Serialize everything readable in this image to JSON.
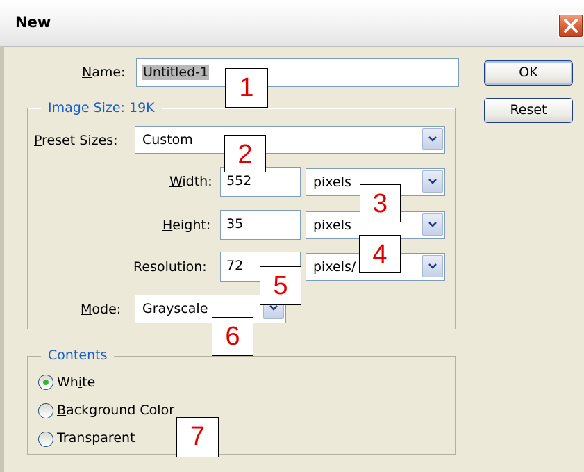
{
  "window": {
    "title": "New"
  },
  "name_field": {
    "label_prefix": "",
    "label_key": "N",
    "label_rest": "ame:",
    "value": "Untitled-1"
  },
  "buttons": {
    "ok": "OK",
    "reset": "Reset"
  },
  "image_size": {
    "group_title": "Image Size: 19K",
    "preset": {
      "label_key": "P",
      "label_rest": "reset Sizes:",
      "value": "Custom"
    },
    "width": {
      "label_key": "W",
      "label_rest": "idth:",
      "value": "552",
      "unit": "pixels"
    },
    "height": {
      "label_key": "H",
      "label_rest": "eight:",
      "value": "35",
      "unit": "pixels"
    },
    "resolution": {
      "label_key": "R",
      "label_rest": "esolution:",
      "value": "72",
      "unit": "pixels/"
    },
    "mode": {
      "label_key": "M",
      "label_rest": "ode:",
      "value": "Grayscale"
    }
  },
  "contents": {
    "group_title": "Contents",
    "options": [
      {
        "pre": "Wh",
        "key": "i",
        "post": "te",
        "checked": true
      },
      {
        "pre": "",
        "key": "B",
        "post": "ackground Color",
        "checked": false
      },
      {
        "pre": "",
        "key": "T",
        "post": "ransparent",
        "checked": false
      }
    ]
  },
  "callouts": [
    "1",
    "2",
    "3",
    "4",
    "5",
    "6",
    "7"
  ],
  "colors": {
    "dialog_bg": "#ece9d8",
    "group_title": "#1a5ec8",
    "callout_text": "#e00000",
    "close_button": "#d65a32",
    "radio_dot": "#3cac3c"
  },
  "icons": {
    "close": "close-x-icon",
    "dropdown": "chevron-down-icon"
  }
}
